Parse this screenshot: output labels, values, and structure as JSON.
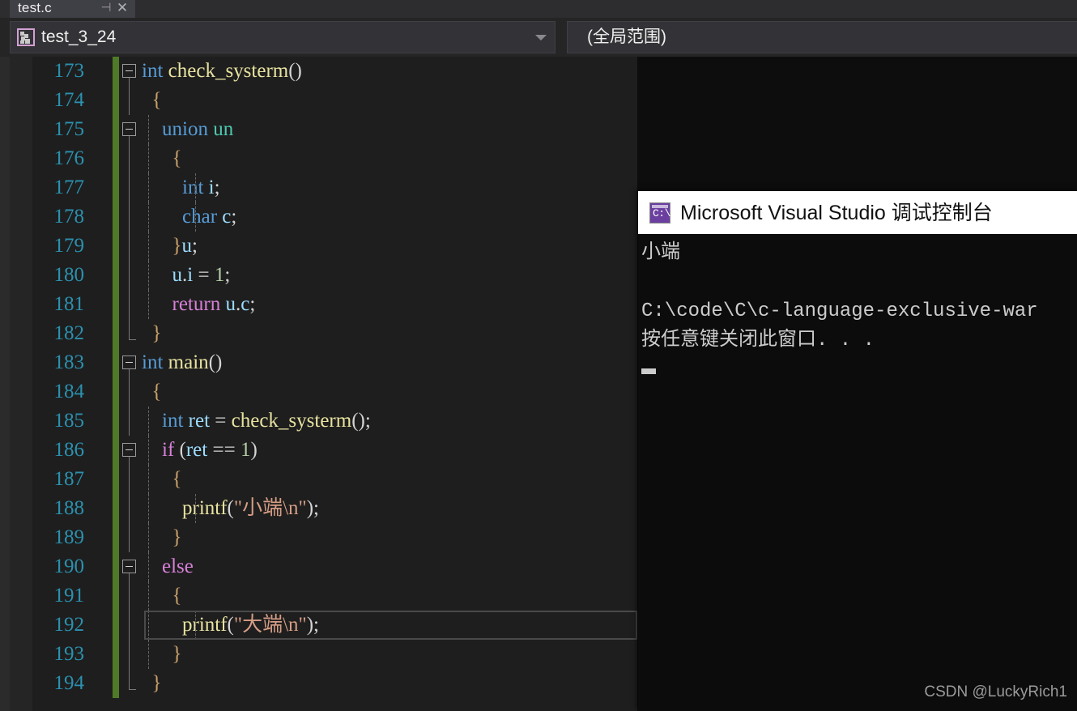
{
  "tab": {
    "label": "test.c",
    "pin_icon": "pin-icon",
    "pin_glyph": "⊣",
    "close_glyph": "✕"
  },
  "navbar": {
    "project_combo": {
      "icon": "member-puzzle-icon",
      "value": "test_3_24",
      "arrow_glyph": "▾"
    },
    "scope_combo": {
      "value": "(全局范围)"
    }
  },
  "editor": {
    "current_line": 192,
    "lines": [
      {
        "number": "173",
        "fold": "box",
        "guides": [],
        "tokens": [
          {
            "t": "int",
            "c": "kw"
          },
          {
            "t": " ",
            "c": "pun"
          },
          {
            "t": "check_systerm",
            "c": "fn"
          },
          {
            "t": "()",
            "c": "pun"
          }
        ]
      },
      {
        "number": "174",
        "fold": "line",
        "guides": [],
        "tokens": [
          {
            "t": "  {",
            "c": "brc"
          }
        ]
      },
      {
        "number": "175",
        "fold": "box",
        "guides": [
          "g1"
        ],
        "tokens": [
          {
            "t": "    ",
            "c": "pun"
          },
          {
            "t": "union",
            "c": "kw"
          },
          {
            "t": " ",
            "c": "pun"
          },
          {
            "t": "un",
            "c": "typ"
          }
        ]
      },
      {
        "number": "176",
        "fold": "line",
        "guides": [
          "g1"
        ],
        "tokens": [
          {
            "t": "      {",
            "c": "brc"
          }
        ]
      },
      {
        "number": "177",
        "fold": "line",
        "guides": [
          "g1",
          "g2"
        ],
        "tokens": [
          {
            "t": "        ",
            "c": "pun"
          },
          {
            "t": "int",
            "c": "kw"
          },
          {
            "t": " ",
            "c": "pun"
          },
          {
            "t": "i",
            "c": "var"
          },
          {
            "t": ";",
            "c": "pun"
          }
        ]
      },
      {
        "number": "178",
        "fold": "line",
        "guides": [
          "g1",
          "g2"
        ],
        "tokens": [
          {
            "t": "        ",
            "c": "pun"
          },
          {
            "t": "char",
            "c": "kw"
          },
          {
            "t": " ",
            "c": "pun"
          },
          {
            "t": "c",
            "c": "var"
          },
          {
            "t": ";",
            "c": "pun"
          }
        ]
      },
      {
        "number": "179",
        "fold": "line",
        "guides": [
          "g1"
        ],
        "tokens": [
          {
            "t": "      }",
            "c": "brc"
          },
          {
            "t": "u",
            "c": "var"
          },
          {
            "t": ";",
            "c": "pun"
          }
        ]
      },
      {
        "number": "180",
        "fold": "line",
        "guides": [
          "g1"
        ],
        "tokens": [
          {
            "t": "      ",
            "c": "pun"
          },
          {
            "t": "u",
            "c": "var"
          },
          {
            "t": ".",
            "c": "pun"
          },
          {
            "t": "i",
            "c": "var"
          },
          {
            "t": " = ",
            "c": "pun"
          },
          {
            "t": "1",
            "c": "num"
          },
          {
            "t": ";",
            "c": "pun"
          }
        ]
      },
      {
        "number": "181",
        "fold": "line",
        "guides": [
          "g1"
        ],
        "tokens": [
          {
            "t": "      ",
            "c": "pun"
          },
          {
            "t": "return",
            "c": "ctl"
          },
          {
            "t": " ",
            "c": "pun"
          },
          {
            "t": "u",
            "c": "var"
          },
          {
            "t": ".",
            "c": "pun"
          },
          {
            "t": "c",
            "c": "var"
          },
          {
            "t": ";",
            "c": "pun"
          }
        ]
      },
      {
        "number": "182",
        "fold": "end",
        "guides": [],
        "tokens": [
          {
            "t": "  }",
            "c": "brc"
          }
        ]
      },
      {
        "number": "183",
        "fold": "box",
        "guides": [],
        "tokens": [
          {
            "t": "int",
            "c": "kw"
          },
          {
            "t": " ",
            "c": "pun"
          },
          {
            "t": "main",
            "c": "fn"
          },
          {
            "t": "()",
            "c": "pun"
          }
        ]
      },
      {
        "number": "184",
        "fold": "line",
        "guides": [],
        "tokens": [
          {
            "t": "  {",
            "c": "brc"
          }
        ]
      },
      {
        "number": "185",
        "fold": "line",
        "guides": [
          "g1"
        ],
        "tokens": [
          {
            "t": "    ",
            "c": "pun"
          },
          {
            "t": "int",
            "c": "kw"
          },
          {
            "t": " ",
            "c": "pun"
          },
          {
            "t": "ret",
            "c": "var"
          },
          {
            "t": " = ",
            "c": "pun"
          },
          {
            "t": "check_systerm",
            "c": "fn"
          },
          {
            "t": "();",
            "c": "pun"
          }
        ]
      },
      {
        "number": "186",
        "fold": "box",
        "guides": [
          "g1"
        ],
        "tokens": [
          {
            "t": "    ",
            "c": "pun"
          },
          {
            "t": "if",
            "c": "ctl"
          },
          {
            "t": " (",
            "c": "pun"
          },
          {
            "t": "ret",
            "c": "var"
          },
          {
            "t": " == ",
            "c": "pun"
          },
          {
            "t": "1",
            "c": "num"
          },
          {
            "t": ")",
            "c": "pun"
          }
        ]
      },
      {
        "number": "187",
        "fold": "line",
        "guides": [
          "g1"
        ],
        "tokens": [
          {
            "t": "      {",
            "c": "brc"
          }
        ]
      },
      {
        "number": "188",
        "fold": "line",
        "guides": [
          "g1",
          "g2"
        ],
        "tokens": [
          {
            "t": "        ",
            "c": "pun"
          },
          {
            "t": "printf",
            "c": "fn"
          },
          {
            "t": "(",
            "c": "pun"
          },
          {
            "t": "\"小端\\n\"",
            "c": "str"
          },
          {
            "t": ");",
            "c": "pun"
          }
        ]
      },
      {
        "number": "189",
        "fold": "line",
        "guides": [
          "g1"
        ],
        "tokens": [
          {
            "t": "      }",
            "c": "brc"
          }
        ]
      },
      {
        "number": "190",
        "fold": "box",
        "guides": [
          "g1"
        ],
        "tokens": [
          {
            "t": "    ",
            "c": "pun"
          },
          {
            "t": "else",
            "c": "ctl"
          }
        ]
      },
      {
        "number": "191",
        "fold": "line",
        "guides": [
          "g1"
        ],
        "tokens": [
          {
            "t": "      {",
            "c": "brc"
          }
        ]
      },
      {
        "number": "192",
        "fold": "line",
        "guides": [
          "g1",
          "g2"
        ],
        "tokens": [
          {
            "t": "        ",
            "c": "pun"
          },
          {
            "t": "printf",
            "c": "fn"
          },
          {
            "t": "(",
            "c": "pun"
          },
          {
            "t": "\"大端\\n\"",
            "c": "str"
          },
          {
            "t": ");",
            "c": "pun"
          }
        ]
      },
      {
        "number": "193",
        "fold": "line",
        "guides": [
          "g1"
        ],
        "tokens": [
          {
            "t": "      }",
            "c": "brc"
          }
        ]
      },
      {
        "number": "194",
        "fold": "end",
        "guides": [],
        "tokens": [
          {
            "t": "  }",
            "c": "brc"
          }
        ]
      }
    ]
  },
  "console": {
    "icon": "console-app-icon",
    "icon_text": "C:\\",
    "title": "Microsoft Visual Studio 调试控制台",
    "output": "小端\n\nC:\\code\\C\\c-language-exclusive-war\n按任意键关闭此窗口. . ."
  },
  "watermark": {
    "text": "CSDN @LuckyRich1"
  },
  "colors": {
    "editor_background": "#1e1e1e",
    "gutter_background": "#252526",
    "line_number": "#2b91af",
    "change_bar": "#4f7a28",
    "keyword": "#569cd6",
    "control_keyword": "#d880d8",
    "function": "#e8e3a0",
    "user_type": "#4ec9b0",
    "variable": "#9cdcfe",
    "string": "#d69d85",
    "number_literal": "#b5cea8",
    "brace": "#c9a06a",
    "console_background": "#0c0c0c",
    "console_titlebar": "#ffffff",
    "combo_background": "#333337",
    "tab_active": "#3f3f46"
  }
}
